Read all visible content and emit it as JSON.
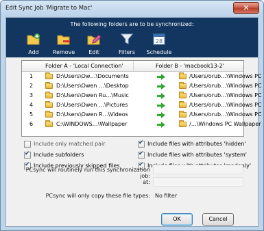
{
  "window": {
    "title": "Edit Sync Job 'Migrate to Mac'",
    "close_glyph": "✕"
  },
  "banner": {
    "heading": "The following folders are to be synchronized:"
  },
  "toolbar": [
    {
      "label": "Add",
      "icon": "add-folder-icon"
    },
    {
      "label": "Remove",
      "icon": "remove-folder-icon"
    },
    {
      "label": "Edit",
      "icon": "edit-pencil-icon"
    },
    {
      "label": "Filters",
      "icon": "filter-funnel-icon"
    },
    {
      "label": "Schedule",
      "icon": "calendar-icon",
      "badge": "28"
    }
  ],
  "grid": {
    "header_a": "Folder A - 'Local Connection'",
    "header_b": "Folder B - 'macbook13-2'",
    "rows": [
      {
        "n": "1",
        "a": "D:\\Users\\Ow…\\Documents",
        "b": "/Users/orub…\\Windows PC"
      },
      {
        "n": "2",
        "a": "D:\\Users\\Owen …\\Desktop",
        "b": "/Users/orub…\\Windows PC"
      },
      {
        "n": "3",
        "a": "D:\\Users\\Owen Ru…\\Music",
        "b": "/Users/orub…\\Windows PC"
      },
      {
        "n": "4",
        "a": "D:\\Users\\Owen …\\Pictures",
        "b": "/Users/orub…\\Windows PC"
      },
      {
        "n": "5",
        "a": "D:\\Users\\Owen R…\\Videos",
        "b": "/Users/orub…\\Windows PC"
      },
      {
        "n": "6",
        "a": "C:\\WINDOWS…\\Wallpaper",
        "b": "/…\\Windows PC Wallpaper"
      }
    ]
  },
  "options": {
    "matched_pair": {
      "label": "Include only matched pair",
      "checked": false
    },
    "subfolders": {
      "label": "Include subfolders",
      "checked": true
    },
    "skipped": {
      "label": "Include previously skipped files",
      "checked": true
    },
    "hidden": {
      "label": "Include files with attributes 'hidden'",
      "checked": true
    },
    "system": {
      "label": "Include files with attributes 'system'",
      "checked": true
    },
    "readonly": {
      "label": "Include files with attributes 'readonly'",
      "checked": true
    }
  },
  "schedule": {
    "run_label": "PCsync will routinely run this synchronization job:",
    "at_label": "at:",
    "filetypes_label": "PCsync will only copy these file types:",
    "filetypes_value": "No filter"
  },
  "buttons": {
    "ok": "OK",
    "cancel": "Cancel"
  },
  "colors": {
    "banner": "#12365f",
    "arrow": "#2fa82f",
    "frame": "#bcd5ea"
  }
}
